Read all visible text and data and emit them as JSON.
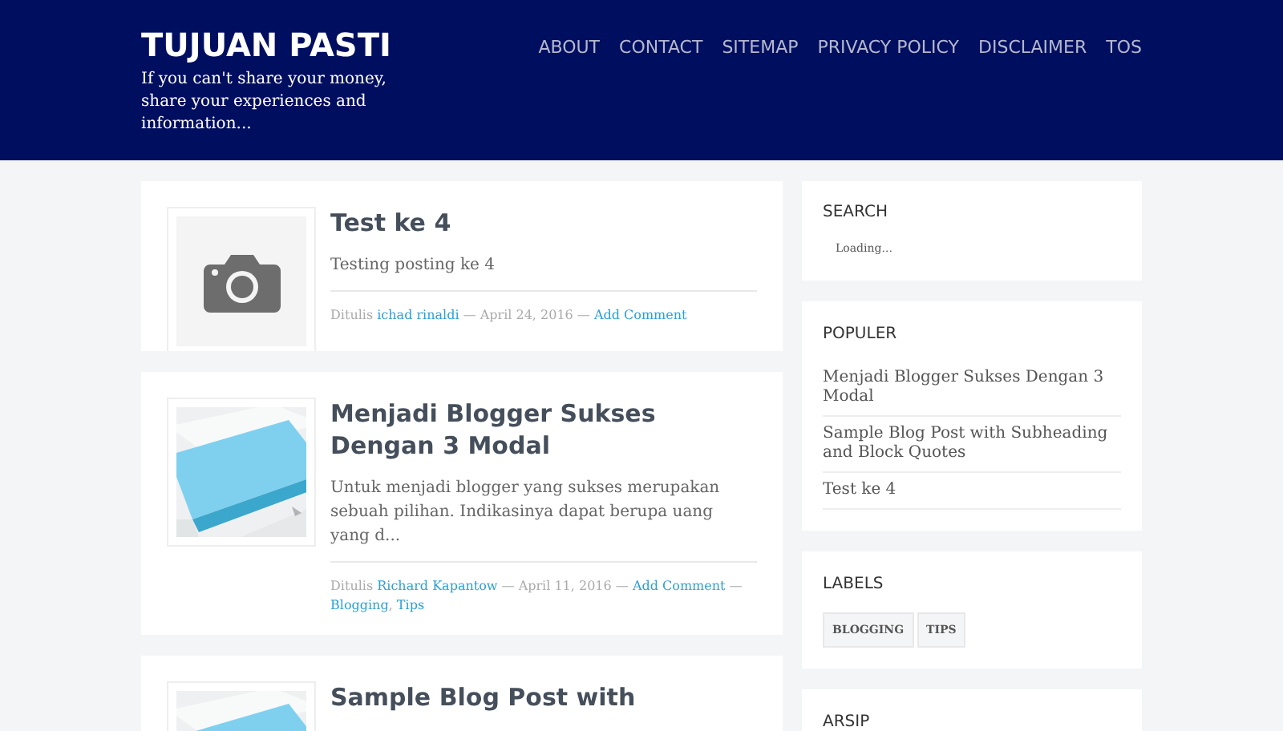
{
  "header": {
    "title": "TUJUAN PASTI",
    "tagline": "If you can't share your money, share your experiences and information...",
    "nav": [
      "ABOUT",
      "CONTACT",
      "SITEMAP",
      "PRIVACY POLICY",
      "DISCLAIMER",
      "TOS"
    ]
  },
  "posts": [
    {
      "thumb": {
        "kind": "camera"
      },
      "title": "Test ke 4",
      "excerpt": "Testing posting ke 4",
      "meta": [
        {
          "kind": "plain",
          "text": "Ditulis "
        },
        {
          "kind": "link",
          "text": "ichad rinaldi"
        },
        {
          "kind": "plain",
          "text": " — April 24, 2016 — "
        },
        {
          "kind": "link",
          "text": "Add Comment"
        }
      ]
    },
    {
      "title": "Menjadi Blogger Sukses Dengan 3 Modal",
      "excerpt": "Untuk menjadi blogger yang sukses merupakan sebuah pilihan. Indikasinya dapat berupa uang yang d...",
      "meta": [
        {
          "kind": "plain",
          "text": "Ditulis "
        },
        {
          "kind": "link",
          "text": "Richard Kapantow"
        },
        {
          "kind": "plain",
          "text": " — April 11, 2016 — "
        },
        {
          "kind": "link",
          "text": "Add Comment"
        },
        {
          "kind": "plain",
          "text": " — "
        },
        {
          "kind": "link",
          "text": "Blogging"
        },
        {
          "kind": "plain",
          "text": ", "
        },
        {
          "kind": "link",
          "text": "Tips"
        }
      ]
    },
    {
      "title": "Sample Blog Post with"
    }
  ],
  "sidebar": {
    "search": {
      "title": "SEARCH",
      "status": "Loading..."
    },
    "popular": {
      "title": "POPULER",
      "items": [
        "Menjadi Blogger Sukses Dengan 3 Modal",
        "Sample Blog Post with Subheading and Block Quotes",
        "Test ke 4"
      ]
    },
    "labels": {
      "title": "LABELS",
      "tags": [
        "BLOGGING",
        "TIPS"
      ]
    },
    "archive": {
      "title": "ARSIP"
    }
  }
}
